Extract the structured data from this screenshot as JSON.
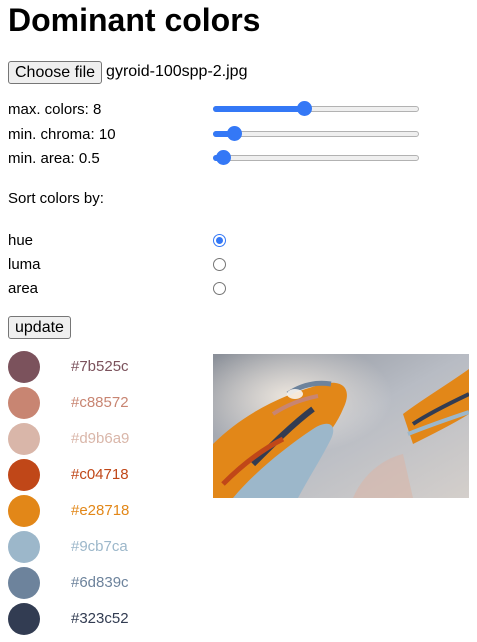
{
  "title": "Dominant colors",
  "file": {
    "button_label": "Choose file",
    "file_name": "gyroid-100spp-2.jpg"
  },
  "sliders": [
    {
      "label": "max. colors: 8",
      "fraction": 0.44
    },
    {
      "label": "min. chroma: 10",
      "fraction": 0.1
    },
    {
      "label": "min. area: 0.5",
      "fraction": 0.05
    }
  ],
  "sort": {
    "label": "Sort colors by:",
    "options": [
      {
        "label": "hue",
        "checked": true
      },
      {
        "label": "luma",
        "checked": false
      },
      {
        "label": "area",
        "checked": false
      }
    ]
  },
  "update_label": "update",
  "colors": [
    {
      "hex": "#7b525c"
    },
    {
      "hex": "#c88572"
    },
    {
      "hex": "#d9b6a9"
    },
    {
      "hex": "#c04718"
    },
    {
      "hex": "#e28718"
    },
    {
      "hex": "#9cb7ca"
    },
    {
      "hex": "#6d839c"
    },
    {
      "hex": "#323c52"
    }
  ]
}
